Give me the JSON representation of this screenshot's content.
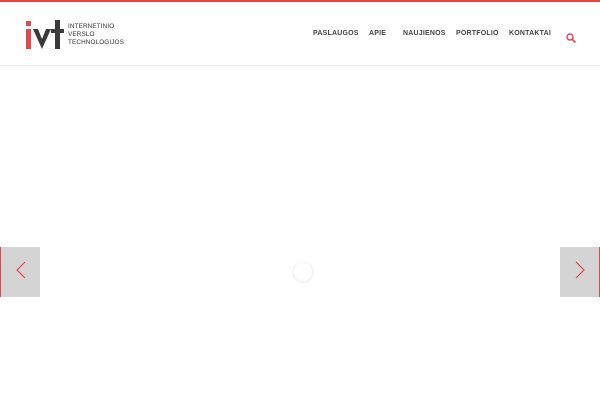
{
  "brand": {
    "logo_lines": [
      "INTERNETINIO",
      "VERSLO",
      "TECHNOLOGIJOS"
    ],
    "accent_color": "#e0484d",
    "dark_color": "#3a3a3a"
  },
  "nav": {
    "items": [
      {
        "label": "PASLAUGOS"
      },
      {
        "label": "APIE"
      },
      {
        "label": "NAUJIENOS"
      },
      {
        "label": "PORTFOLIO"
      },
      {
        "label": "KONTAKTAI"
      }
    ],
    "search_icon": "search-icon"
  },
  "slider": {
    "prev_icon": "chevron-left-icon",
    "next_icon": "chevron-right-icon",
    "arrow_background": "#d4d4d4",
    "loading": true
  }
}
